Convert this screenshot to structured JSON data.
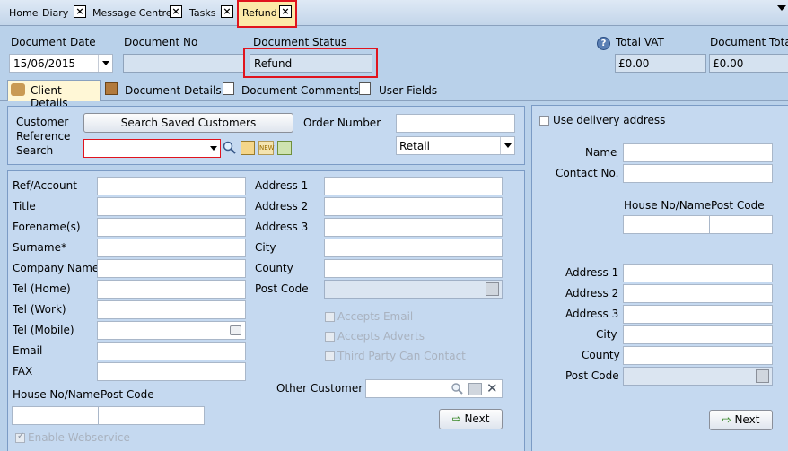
{
  "tabs": [
    {
      "label": "Home"
    },
    {
      "label": "Diary"
    },
    {
      "label": "Message Centre"
    },
    {
      "label": "Tasks"
    },
    {
      "label": "Refund"
    }
  ],
  "header": {
    "document_date_label": "Document Date",
    "document_date_value": "15/06/2015",
    "document_no_label": "Document No",
    "document_no_value": "",
    "document_status_label": "Document Status",
    "document_status_value": "Refund",
    "total_vat_label": "Total VAT",
    "total_vat_value": "£0.00",
    "document_total_label": "Document Tota",
    "document_total_value": "£0.00"
  },
  "subtabs": [
    {
      "label": "Client Details"
    },
    {
      "label": "Document Details"
    },
    {
      "label": "Document Comments"
    },
    {
      "label": "User Fields"
    }
  ],
  "search": {
    "customer_reference_label_1": "Customer",
    "customer_reference_label_2": "Reference",
    "customer_reference_label_3": "Search",
    "search_saved_customers_label": "Search Saved Customers",
    "order_number_label": "Order Number",
    "order_number_value": "",
    "price_type_value": "Retail"
  },
  "client": {
    "ref_account_label": "Ref/Account",
    "title_label": "Title",
    "forenames_label": "Forename(s)",
    "surname_label": "Surname*",
    "company_name_label": "Company Name",
    "tel_home_label": "Tel (Home)",
    "tel_work_label": "Tel (Work)",
    "tel_mobile_label": "Tel (Mobile)",
    "email_label": "Email",
    "fax_label": "FAX",
    "house_no_label": "House No/Name",
    "post_code_label": "Post Code",
    "enable_webservice_label": "Enable Webservice",
    "address1_label": "Address 1",
    "address2_label": "Address 2",
    "address3_label": "Address 3",
    "city_label": "City",
    "county_label": "County",
    "postcode_label": "Post Code",
    "accepts_email_label": "Accepts Email",
    "accepts_adverts_label": "Accepts Adverts",
    "third_party_label": "Third Party Can Contact",
    "other_customer_label": "Other Customer",
    "next_label": "Next"
  },
  "delivery": {
    "use_delivery_label": "Use delivery address",
    "name_label": "Name",
    "contact_no_label": "Contact No.",
    "house_no_label": "House No/Name",
    "post_code_label": "Post Code",
    "address1_label": "Address 1",
    "address2_label": "Address 2",
    "address3_label": "Address 3",
    "city_label": "City",
    "county_label": "County",
    "postcode_label": "Post Code",
    "next_label": "Next"
  }
}
